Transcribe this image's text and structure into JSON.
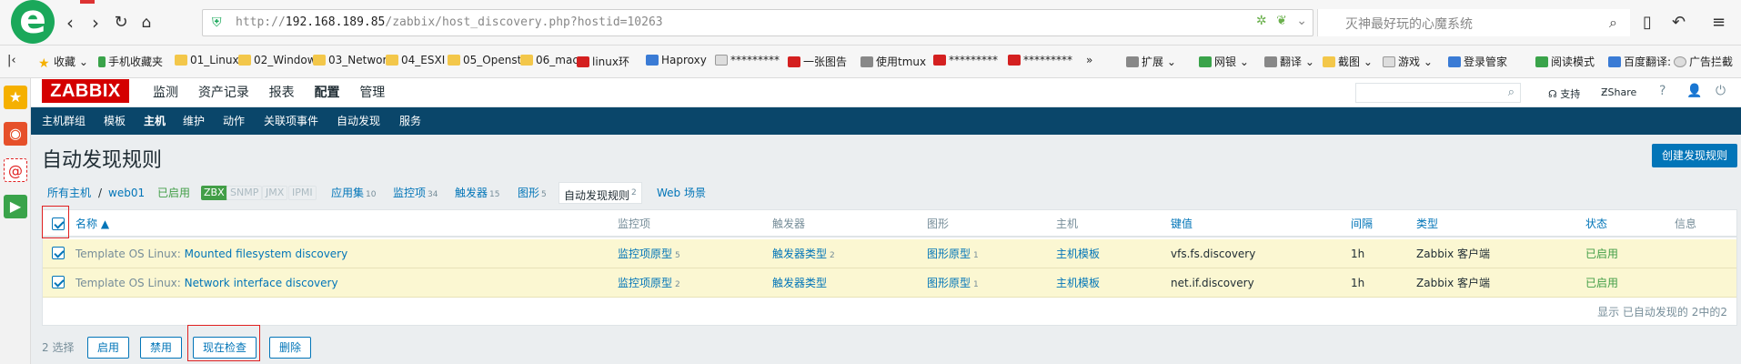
{
  "browser": {
    "url_prefix": "http://",
    "url_host": "192.168.189.85",
    "url_path": "/zabbix/host_discovery.php?hostid=10263",
    "search_placeholder": "灭神最好玩的心魔系统",
    "bookmarks": [
      "收藏",
      "手机收藏夹",
      "01_Linux",
      "02_Window",
      "03_Networ",
      "04_ESXI",
      "05_Openst",
      "06_mac",
      "linux环",
      "Haproxy",
      "*********",
      "一张图告",
      "使用tmux",
      "*********",
      "*********",
      "»"
    ],
    "toolbar": [
      "扩展",
      "网银",
      "翻译",
      "截图",
      "游戏",
      "登录管家",
      "阅读模式",
      "百度翻译:",
      "广告拦截"
    ]
  },
  "zabbix": {
    "logo": "ZABBIX",
    "main_menu": [
      "监测",
      "资产记录",
      "报表",
      "配置",
      "管理"
    ],
    "main_menu_active": 3,
    "support": "支持",
    "share": "Share",
    "help": "?",
    "sub_menu": [
      "主机群组",
      "模板",
      "主机",
      "维护",
      "动作",
      "关联项事件",
      "自动发现",
      "服务"
    ],
    "sub_menu_active": 2
  },
  "page": {
    "title": "自动发现规则",
    "create_button": "创建发现规则"
  },
  "breadcrumbs": {
    "all_hosts": "所有主机",
    "separator": "/",
    "host": "web01",
    "status": "已启用",
    "interfaces": [
      "ZBX",
      "SNMP",
      "JMX",
      "IPMI"
    ],
    "tabs": [
      {
        "label": "应用集",
        "count": "10"
      },
      {
        "label": "监控项",
        "count": "34"
      },
      {
        "label": "触发器",
        "count": "15"
      },
      {
        "label": "图形",
        "count": "5"
      },
      {
        "label": "自动发现规则",
        "count": "2"
      },
      {
        "label": "Web 场景",
        "count": ""
      }
    ]
  },
  "table": {
    "headers": {
      "name": "名称 ▲",
      "items": "监控项",
      "triggers": "触发器",
      "graphs": "图形",
      "hosts": "主机",
      "key": "键值",
      "interval": "间隔",
      "type": "类型",
      "status": "状态",
      "info": "信息"
    },
    "rows": [
      {
        "template": "Template OS Linux:",
        "name": "Mounted filesystem discovery",
        "items": "监控项原型",
        "items_count": "5",
        "triggers": "触发器类型",
        "triggers_count": "2",
        "graphs": "图形原型",
        "graphs_count": "1",
        "hosts": "主机模板",
        "key": "vfs.fs.discovery",
        "interval": "1h",
        "type": "Zabbix 客户端",
        "status": "已启用"
      },
      {
        "template": "Template OS Linux:",
        "name": "Network interface discovery",
        "items": "监控项原型",
        "items_count": "2",
        "triggers": "触发器类型",
        "triggers_count": "",
        "graphs": "图形原型",
        "graphs_count": "1",
        "hosts": "主机模板",
        "key": "net.if.discovery",
        "interval": "1h",
        "type": "Zabbix 客户端",
        "status": "已启用"
      }
    ],
    "footer": "显示 已自动发现的 2中的2"
  },
  "actions": {
    "selected": "2 选择",
    "enable": "启用",
    "disable": "禁用",
    "check_now": "现在检查",
    "delete": "删除"
  },
  "colors": {
    "zabbix_red": "#d40000",
    "nav_blue": "#0a466a",
    "link": "#0275b8",
    "enabled": "#429e47",
    "row_highlight": "#fbf7d2"
  }
}
